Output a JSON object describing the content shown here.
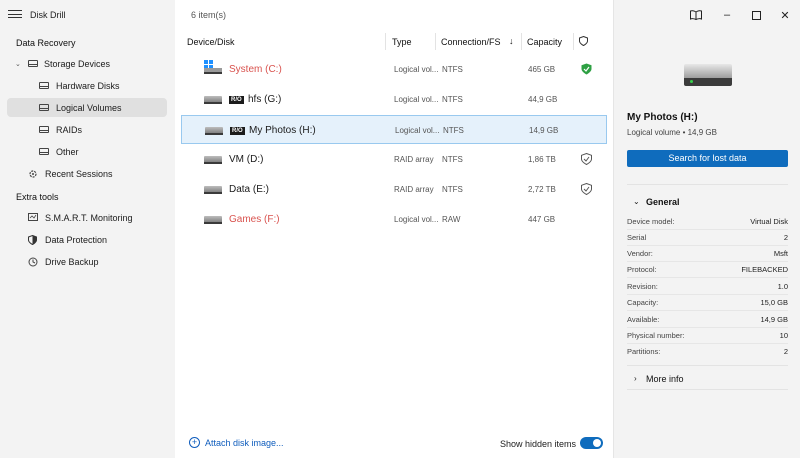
{
  "app": {
    "title": "Disk Drill"
  },
  "sidebar": {
    "data_recovery_title": "Data Recovery",
    "storage_devices": "Storage Devices",
    "hardware_disks": "Hardware Disks",
    "logical_volumes": "Logical Volumes",
    "raids": "RAIDs",
    "other": "Other",
    "recent_sessions": "Recent Sessions",
    "extra_tools_title": "Extra tools",
    "smart_monitoring": "S.M.A.R.T. Monitoring",
    "data_protection": "Data Protection",
    "drive_backup": "Drive Backup"
  },
  "main": {
    "items_count": "6 item(s)",
    "columns": {
      "device": "Device/Disk",
      "type": "Type",
      "connection": "Connection/FS",
      "capacity": "Capacity"
    },
    "rows": [
      {
        "name": "System (C:)",
        "ro": "",
        "type": "Logical vol...",
        "fs": "NTFS",
        "capacity": "465 GB",
        "status": "protected",
        "red": true,
        "icon": "windows-drive-icon"
      },
      {
        "name": "hfs (G:)",
        "ro": "R/O",
        "type": "Logical vol...",
        "fs": "NTFS",
        "capacity": "44,9 GB",
        "status": "",
        "red": false,
        "icon": "drive-icon"
      },
      {
        "name": "My Photos (H:)",
        "ro": "R/O",
        "type": "Logical vol...",
        "fs": "NTFS",
        "capacity": "14,9 GB",
        "status": "",
        "red": false,
        "icon": "drive-icon"
      },
      {
        "name": "VM (D:)",
        "ro": "",
        "type": "RAID array",
        "fs": "NTFS",
        "capacity": "1,86 TB",
        "status": "outline",
        "red": false,
        "icon": "drive-icon"
      },
      {
        "name": "Data (E:)",
        "ro": "",
        "type": "RAID array",
        "fs": "NTFS",
        "capacity": "2,72 TB",
        "status": "outline",
        "red": false,
        "icon": "drive-icon"
      },
      {
        "name": "Games (F:)",
        "ro": "",
        "type": "Logical vol...",
        "fs": "RAW",
        "capacity": "447 GB",
        "status": "",
        "red": true,
        "icon": "drive-icon"
      }
    ],
    "attach": "Attach disk image...",
    "show_hidden": "Show hidden items",
    "show_hidden_on": true
  },
  "details": {
    "title": "My Photos (H:)",
    "subtitle": "Logical volume • 14,9 GB",
    "search_button": "Search for lost data",
    "general": "General",
    "properties": [
      {
        "k": "Device model:",
        "v": "Virtual Disk"
      },
      {
        "k": "Serial",
        "v": "2"
      },
      {
        "k": "Vendor:",
        "v": "Msft"
      },
      {
        "k": "Protocol:",
        "v": "FILEBACKED"
      },
      {
        "k": "Revision:",
        "v": "1.0"
      },
      {
        "k": "Capacity:",
        "v": "15,0 GB"
      },
      {
        "k": "Available:",
        "v": "14,9 GB"
      },
      {
        "k": "Physical number:",
        "v": "10"
      },
      {
        "k": "Partitions:",
        "v": "2"
      }
    ],
    "more_info": "More info"
  },
  "colors": {
    "accent": "#0f6cbd",
    "danger": "#d9534f",
    "protected": "#2ea043",
    "selected_bg": "#e5f1fb"
  }
}
